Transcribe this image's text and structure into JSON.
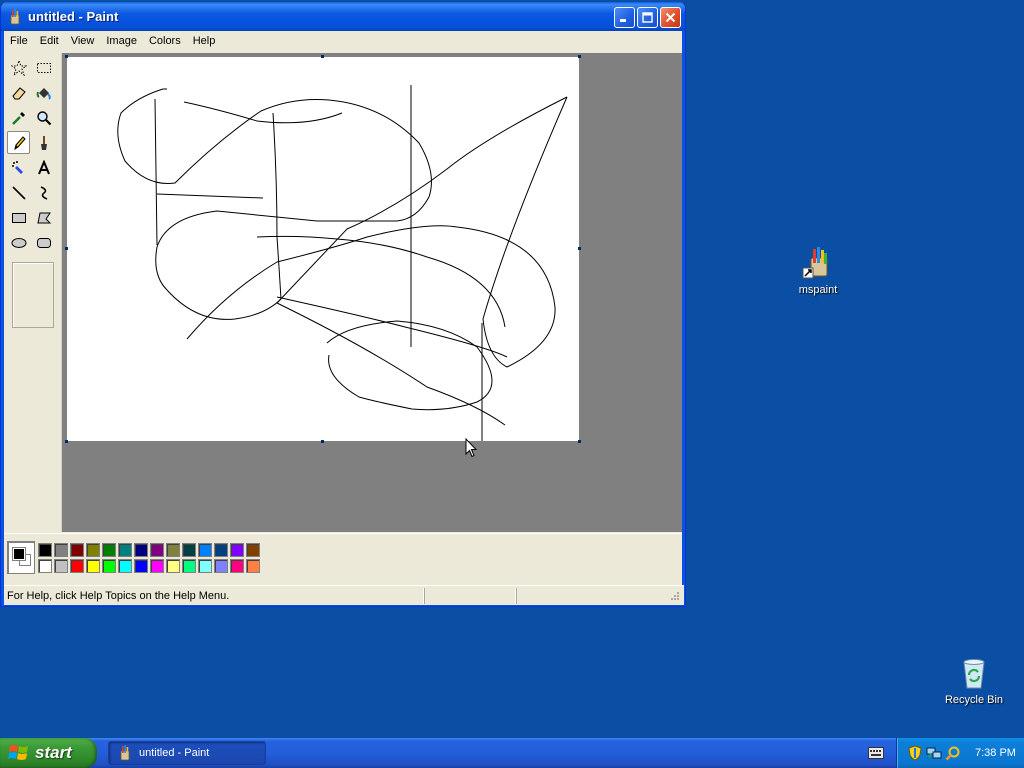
{
  "window": {
    "title": "untitled - Paint",
    "menu": [
      "File",
      "Edit",
      "View",
      "Image",
      "Colors",
      "Help"
    ],
    "status_text": "For Help, click Help Topics on the Help Menu."
  },
  "tools": [
    {
      "name": "free-form-select-icon"
    },
    {
      "name": "select-icon"
    },
    {
      "name": "eraser-icon"
    },
    {
      "name": "fill-with-color-icon"
    },
    {
      "name": "pick-color-icon"
    },
    {
      "name": "magnifier-icon"
    },
    {
      "name": "pencil-icon",
      "active": true
    },
    {
      "name": "brush-icon"
    },
    {
      "name": "airbrush-icon"
    },
    {
      "name": "text-icon"
    },
    {
      "name": "line-icon"
    },
    {
      "name": "curve-icon"
    },
    {
      "name": "rectangle-icon"
    },
    {
      "name": "polygon-icon"
    },
    {
      "name": "ellipse-icon"
    },
    {
      "name": "rounded-rectangle-icon"
    }
  ],
  "palette": {
    "foreground": "#000000",
    "background": "#ffffff",
    "top_row": [
      "#000000",
      "#808080",
      "#800000",
      "#808000",
      "#008000",
      "#008080",
      "#000080",
      "#800080",
      "#808040",
      "#004040",
      "#0080ff",
      "#004080",
      "#8000ff",
      "#804000"
    ],
    "bottom_row": [
      "#ffffff",
      "#c0c0c0",
      "#ff0000",
      "#ffff00",
      "#00ff00",
      "#00ffff",
      "#0000ff",
      "#ff00ff",
      "#ffff80",
      "#00ff80",
      "#80ffff",
      "#8080ff",
      "#ff0080",
      "#ff8040"
    ]
  },
  "desktop": {
    "icons": [
      {
        "label": "mspaint"
      },
      {
        "label": "Recycle Bin"
      }
    ]
  },
  "taskbar": {
    "start_label": "start",
    "task_label": "untitled - Paint",
    "clock": "7:38 PM"
  },
  "colors": {
    "desktop": "#0a4fa3",
    "titlebar": "#0b58e2",
    "chrome": "#ece9d8",
    "workspace": "#808080"
  }
}
